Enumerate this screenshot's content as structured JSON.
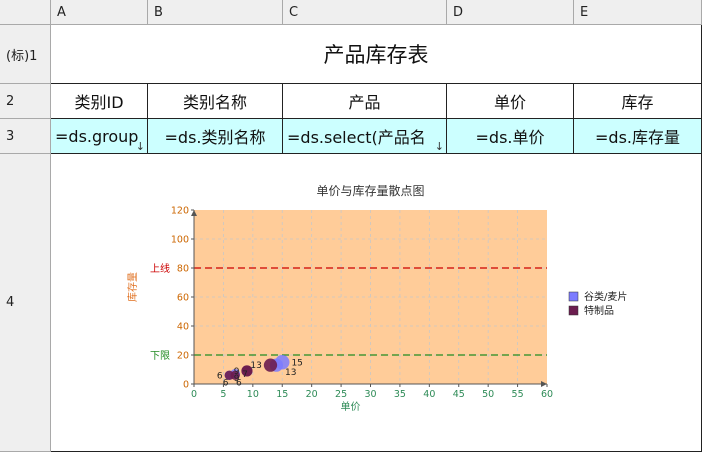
{
  "sheet": {
    "corner": "",
    "columns": [
      "A",
      "B",
      "C",
      "D",
      "E"
    ],
    "rows": [
      "(标)1",
      "2",
      "3",
      "4"
    ],
    "title": "产品库存表",
    "headers": [
      "类别ID",
      "类别名称",
      "产品",
      "单价",
      "库存"
    ],
    "expressions": [
      "=ds.group",
      "=ds.类别名称",
      "=ds.select(产品名",
      "=ds.单价",
      "=ds.库存量"
    ],
    "expand_arrow": "↓"
  },
  "chart_data": {
    "type": "scatter",
    "title": "单价与库存量散点图",
    "xlabel": "单价",
    "ylabel": "库存量",
    "xlim": [
      0,
      60
    ],
    "ylim": [
      0,
      120
    ],
    "x_ticks": [
      "0",
      "5",
      "10",
      "15",
      "20",
      "25",
      "30",
      "35",
      "40",
      "45",
      "50",
      "55",
      "60"
    ],
    "y_ticks": [
      "0",
      "20",
      "40",
      "60",
      "80",
      "100",
      "120"
    ],
    "grid": true,
    "plot_background": "#ffcc99",
    "legend_position": "right",
    "reference_lines": [
      {
        "label": "上线",
        "value": 80,
        "color": "#cc0000"
      },
      {
        "label": "下限",
        "value": 20,
        "color": "#228b22"
      }
    ],
    "series": [
      {
        "name": "谷类/麦片",
        "color": "#7b7bff",
        "points": [
          {
            "x": 15,
            "y": 15,
            "label": "15"
          },
          {
            "x": 14,
            "y": 13,
            "label": "13"
          },
          {
            "x": 7,
            "y": 7,
            "label": "7"
          },
          {
            "x": 6,
            "y": 6,
            "label": "6"
          }
        ]
      },
      {
        "name": "特制品",
        "color": "#6b1d4f",
        "points": [
          {
            "x": 13,
            "y": 13,
            "label": "13"
          },
          {
            "x": 9,
            "y": 9,
            "label": "9"
          },
          {
            "x": 9,
            "y": 9,
            "label": "9"
          },
          {
            "x": 7,
            "y": 6,
            "label": "6"
          },
          {
            "x": 6,
            "y": 6,
            "label": "6"
          }
        ]
      }
    ]
  }
}
